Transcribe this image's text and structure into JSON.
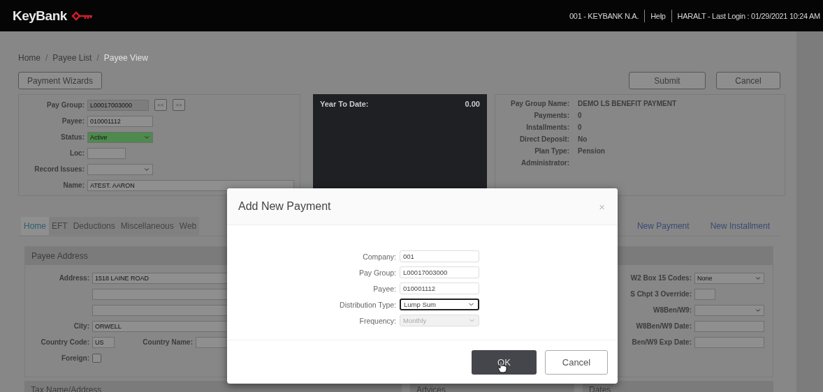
{
  "header": {
    "brand": "KeyBank",
    "bank": "001 - KEYBANK N.A.",
    "help": "Help",
    "user": "HARALT - Last Login : 01/29/2021 10:24 AM"
  },
  "breadcrumb": {
    "separator": "/",
    "items": [
      {
        "label": "Home",
        "selected": false
      },
      {
        "label": "Payee List",
        "selected": false
      },
      {
        "label": "Payee View",
        "selected": true
      }
    ]
  },
  "toolbar": {
    "wizards": "Payment Wizards",
    "submit": "Submit",
    "cancel": "Cancel"
  },
  "payee_fields": [
    {
      "label": "Pay Group:",
      "value": "L00017003000",
      "kind": "locked",
      "nav": [
        "<<",
        ">>"
      ]
    },
    {
      "label": "Payee:",
      "value": "010001112",
      "kind": "input"
    },
    {
      "label": "Status:",
      "value": "Active",
      "kind": "status"
    },
    {
      "label": "Loc:",
      "kind": "short"
    },
    {
      "label": "Record Issues:",
      "kind": "select"
    },
    {
      "label": "Name:",
      "value": "ATEST. AARON",
      "kind": "wide"
    }
  ],
  "ytd": {
    "label": "Year To Date:",
    "value": "0.00"
  },
  "summary": [
    {
      "label": "Pay Group Name:",
      "value": "DEMO LS BENEFIT PAYMENT"
    },
    {
      "label": "Payments:",
      "value": "0"
    },
    {
      "label": "Installments:",
      "value": "0"
    },
    {
      "label": "Direct Deposit:",
      "value": "No"
    },
    {
      "label": "Plan Type:",
      "value": "Pension"
    },
    {
      "label": "Administrator:"
    }
  ],
  "tabs": [
    {
      "label": "Home",
      "selected": true
    },
    {
      "label": "EFT",
      "selected": false
    },
    {
      "label": "Deductions",
      "selected": false
    },
    {
      "label": "Miscellaneous",
      "selected": false
    },
    {
      "label": "Web",
      "selected": false
    }
  ],
  "actions": [
    "New Payment",
    "New Installment"
  ],
  "payee_address": {
    "title": "Payee Address",
    "fields": [
      {
        "kind": "input",
        "label": "Address:",
        "value": "1518 LAINE ROAD"
      },
      {
        "kind": "line"
      },
      {
        "kind": "line"
      },
      {
        "kind": "input",
        "label": "City:",
        "value": "ORWELL"
      },
      {
        "kind": "country",
        "label": "Country Code:",
        "value": "US",
        "second_label": "Country Name:"
      },
      {
        "kind": "checkbox",
        "label": "Foreign:",
        "checked": false
      }
    ]
  },
  "tax_fields": [
    {
      "label": "W2 Box 15 Codes:",
      "value": "None",
      "kind": "select"
    },
    {
      "label": "S Chpt 3 Override:",
      "kind": "short"
    },
    {
      "label": "W8Ben/W9:",
      "kind": "select"
    },
    {
      "label": "W8Ben/W9 Date:",
      "kind": "input"
    },
    {
      "label": "Ben/W9 Exp Date:",
      "kind": "input"
    }
  ],
  "sections": [
    "Tax Name/Address",
    "Advices",
    "Dates"
  ],
  "dialog": {
    "title": "Add New Payment",
    "close": "×",
    "fields": [
      {
        "label": "Company:",
        "value": "001",
        "kind": "input",
        "focused": false,
        "disabled": false
      },
      {
        "label": "Pay Group:",
        "value": "L00017003000",
        "kind": "input",
        "focused": false,
        "disabled": false
      },
      {
        "label": "Payee:",
        "value": "010001112",
        "kind": "input",
        "focused": false,
        "disabled": false
      },
      {
        "label": "Distribution Type:",
        "value": "Lump Sum",
        "kind": "select",
        "focused": true,
        "disabled": false
      },
      {
        "label": "Frequency:",
        "value": "Monthly",
        "kind": "select",
        "focused": false,
        "disabled": true
      }
    ],
    "ok": "OK",
    "cancel": "Cancel"
  }
}
